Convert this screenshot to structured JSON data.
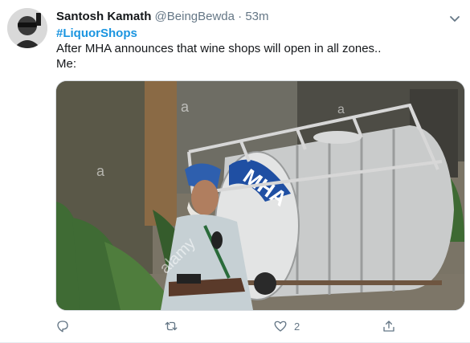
{
  "tweet": {
    "display_name": "Santosh Kamath",
    "handle": "@BeingBewda",
    "separator": "·",
    "time": "53m",
    "hashtag": "#LiquorShops",
    "line1": "After MHA announces that wine shops will open in all zones..",
    "line2": "Me:"
  },
  "media": {
    "tank_text": "MHA",
    "watermarks": [
      "a",
      "a",
      "a",
      "alamy"
    ]
  },
  "actions": {
    "reply_icon": "reply-icon",
    "retweet_icon": "retweet-icon",
    "like_icon": "heart-icon",
    "like_count": "2",
    "share_icon": "share-icon"
  },
  "colors": {
    "link": "#1b95e0",
    "secondary_text": "#657786",
    "tank_blue": "#1f4fa3"
  }
}
